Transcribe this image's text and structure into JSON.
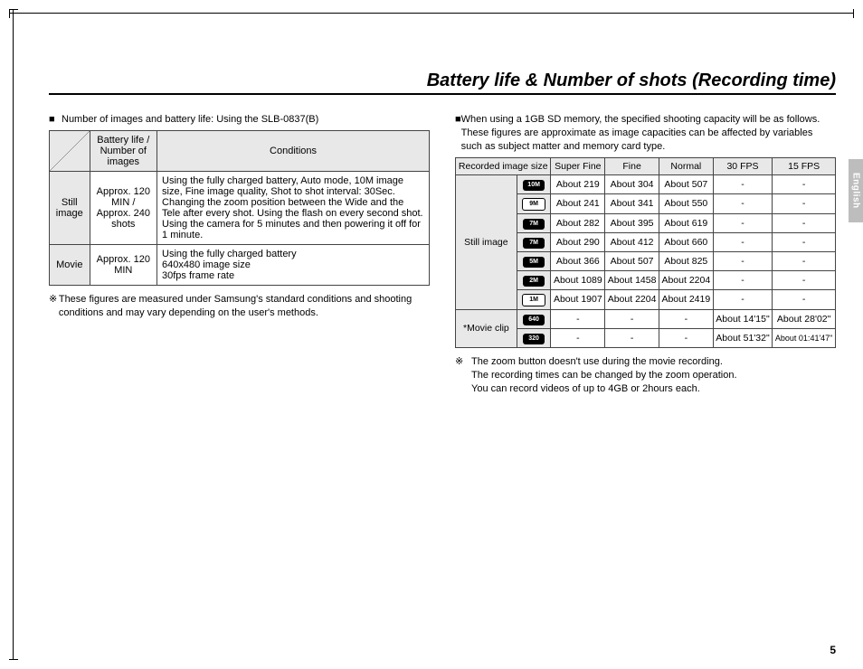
{
  "page_title": "Battery life & Number of shots (Recording time)",
  "side_tab": "English",
  "page_number": "5",
  "left": {
    "bullet": "Number of images and battery life: Using the SLB-0837(B)",
    "headers": {
      "col2": "Battery life / Number of images",
      "col3": "Conditions"
    },
    "rows": [
      {
        "label": "Still image",
        "value": "Approx. 120 MIN / Approx. 240 shots",
        "cond": "Using the fully charged battery, Auto mode, 10M image size, Fine image quality, Shot to shot interval: 30Sec. Changing the zoom position between the Wide and the Tele after every shot. Using the flash on every second shot. Using the camera for 5 minutes and then powering it off for 1 minute."
      },
      {
        "label": "Movie",
        "value": "Approx. 120 MIN",
        "cond": "Using the fully charged battery\n640x480 image size\n30fps frame rate"
      }
    ],
    "note": "These figures are measured under Samsung's standard conditions and shooting conditions and may vary depending on the user's methods."
  },
  "right": {
    "bullet": "When using a 1GB SD memory, the specified shooting capacity will be as follows. These figures are approximate as image capacities can be affected by variables such as subject matter and memory card type.",
    "headers": {
      "col1": "Recorded image size",
      "c1": "Super Fine",
      "c2": "Fine",
      "c3": "Normal",
      "c4": "30 FPS",
      "c5": "15 FPS"
    },
    "group_still": "Still image",
    "group_movie": "*Movie clip",
    "still": [
      {
        "icon": "10M",
        "sf": "About 219",
        "f": "About 304",
        "n": "About 507",
        "fps30": "-",
        "fps15": "-"
      },
      {
        "icon": "9M",
        "sf": "About 241",
        "f": "About 341",
        "n": "About 550",
        "fps30": "-",
        "fps15": "-"
      },
      {
        "icon": "7M",
        "sf": "About 282",
        "f": "About 395",
        "n": "About 619",
        "fps30": "-",
        "fps15": "-"
      },
      {
        "icon": "7M",
        "sf": "About 290",
        "f": "About 412",
        "n": "About 660",
        "fps30": "-",
        "fps15": "-"
      },
      {
        "icon": "5M",
        "sf": "About 366",
        "f": "About 507",
        "n": "About 825",
        "fps30": "-",
        "fps15": "-"
      },
      {
        "icon": "2M",
        "sf": "About 1089",
        "f": "About 1458",
        "n": "About 2204",
        "fps30": "-",
        "fps15": "-"
      },
      {
        "icon": "1M",
        "sf": "About 1907",
        "f": "About 2204",
        "n": "About 2419",
        "fps30": "-",
        "fps15": "-"
      }
    ],
    "movie": [
      {
        "icon": "640",
        "sf": "-",
        "f": "-",
        "n": "-",
        "fps30": "About 14'15\"",
        "fps15": "About 28'02\""
      },
      {
        "icon": "320",
        "sf": "-",
        "f": "-",
        "n": "-",
        "fps30": "About 51'32\"",
        "fps15": "About 01:41'47\""
      }
    ],
    "note": "The zoom button doesn't use during the movie recording.",
    "note2": "The recording times can be changed by the zoom operation.",
    "note3": "You can record videos of up to 4GB or 2hours each."
  }
}
